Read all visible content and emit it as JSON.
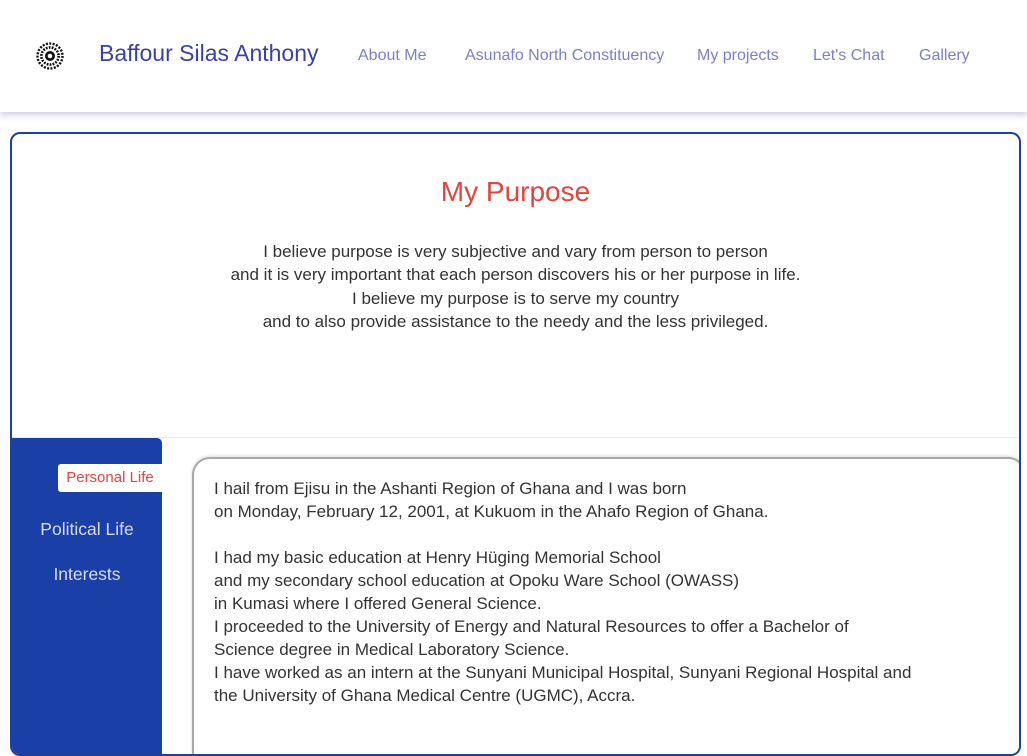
{
  "header": {
    "logo_icon": "sunburst-logo-icon",
    "brand": "Baffour Silas Anthony",
    "nav": [
      "About Me",
      "Asunafo North Constituency",
      "My projects",
      "Let's Chat",
      "Gallery"
    ]
  },
  "purpose": {
    "title": "My Purpose",
    "lines": [
      "I believe purpose is very subjective and vary from person to person",
      "and it is very important that each person discovers his or her purpose in life.",
      "I believe my purpose is to serve my country",
      "and to also provide assistance to the needy and the less privileged."
    ]
  },
  "sidebar": {
    "items": [
      "Personal Life",
      "Political Life",
      "Interests"
    ],
    "active_index": 0
  },
  "content": {
    "paragraph1": [
      "I hail from Ejisu in the Ashanti Region of Ghana and I was born",
      "on Monday, February 12, 2001, at Kukuom in the Ahafo Region of Ghana."
    ],
    "paragraph2": [
      "I had my basic education at Henry Hüging Memorial School",
      "and my secondary school education at Opoku Ware School (OWASS)",
      "in Kumasi where I offered General Science.",
      "I proceeded to the University of Energy and Natural Resources to offer a Bachelor of",
      "Science degree in Medical Laboratory Science.",
      "I have worked as an intern at the Sunyani Municipal Hospital, Sunyani Regional Hospital and",
      "the University of Ghana Medical Centre (UGMC), Accra."
    ]
  },
  "colors": {
    "brand": "#3b3fa8",
    "nav": "#7b7fc9",
    "accent_red": "#e0453f",
    "sidebar_blue": "#1a3fa6",
    "card_border": "#1d3f9e"
  }
}
